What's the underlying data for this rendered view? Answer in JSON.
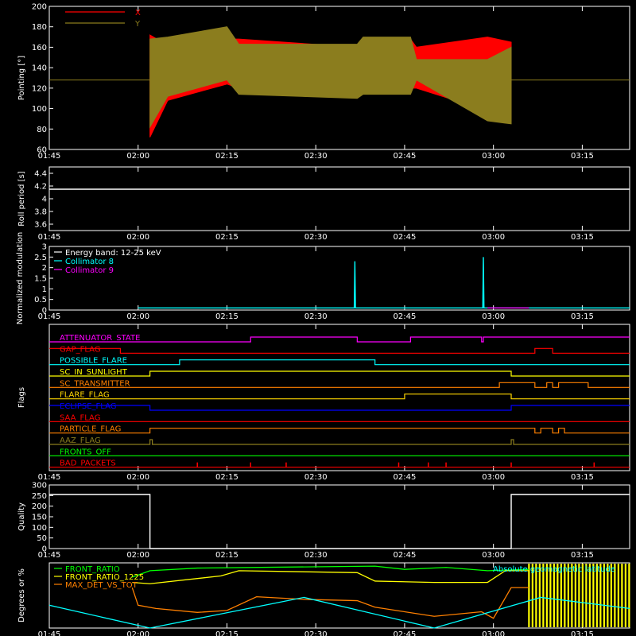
{
  "chart_data": [
    {
      "type": "line",
      "ylabel": "Pointing [°]",
      "ylim": [
        60,
        200
      ],
      "yticks": [
        60,
        80,
        100,
        120,
        140,
        160,
        180,
        200
      ],
      "xticks": [
        "01:45",
        "02:00",
        "02:15",
        "02:30",
        "02:45",
        "03:00",
        "03:15"
      ],
      "legend": {
        "placement": "top-left",
        "entries": [
          {
            "name": "X",
            "color": "#ff0000"
          },
          {
            "name": "Y",
            "color": "#8b7d1e"
          }
        ]
      },
      "series": [
        {
          "name": "X",
          "color": "#ff0000",
          "x": [
            "02:02",
            "02:05",
            "02:15",
            "02:17",
            "02:37",
            "02:38",
            "02:46",
            "02:47",
            "02:59",
            "03:03"
          ],
          "y_high": [
            172,
            162,
            168,
            168,
            160,
            168,
            168,
            160,
            170,
            165
          ],
          "y_low": [
            72,
            108,
            124,
            120,
            112,
            120,
            120,
            120,
            98,
            88
          ]
        },
        {
          "name": "Y",
          "color": "#8b7d1e",
          "x": [
            "02:02",
            "02:05",
            "02:15",
            "02:17",
            "02:37",
            "02:38",
            "02:46",
            "02:47",
            "02:59",
            "03:03"
          ],
          "y_high": [
            168,
            170,
            180,
            163,
            163,
            170,
            170,
            148,
            148,
            160
          ],
          "y_low": [
            82,
            112,
            128,
            114,
            110,
            114,
            114,
            128,
            88,
            85
          ]
        }
      ],
      "baseline": 128
    },
    {
      "type": "line",
      "ylabel": "Roll period [s]",
      "ylim": [
        3.5,
        4.5
      ],
      "yticks": [
        3.6,
        3.8,
        4.0,
        4.2,
        4.4
      ],
      "xticks": [
        "01:45",
        "02:00",
        "02:15",
        "02:30",
        "02:45",
        "03:00",
        "03:15"
      ],
      "series": [
        {
          "x": [
            "01:45",
            "03:23"
          ],
          "y": [
            4.15,
            4.15
          ],
          "color": "#ffffff"
        }
      ]
    },
    {
      "type": "line",
      "ylabel": "Normalized modulation",
      "ylim": [
        0,
        3.0
      ],
      "yticks": [
        0.0,
        0.5,
        1.0,
        1.5,
        2.0,
        2.5,
        3.0
      ],
      "xticks": [
        "01:45",
        "02:00",
        "02:15",
        "02:30",
        "02:45",
        "03:00",
        "03:15"
      ],
      "legend": {
        "placement": "top-left",
        "entries": [
          {
            "name": "Energy band: 12-25 keV",
            "color": "#ffffff"
          },
          {
            "name": "Collimator 8",
            "color": "#00ffff"
          },
          {
            "name": "Collimator 9",
            "color": "#ff00ff"
          }
        ]
      },
      "series": [
        {
          "name": "Collimator 8",
          "color": "#00ffff",
          "x": [
            "02:00",
            "02:36.5",
            "02:36.6",
            "02:36.7",
            "02:58.2",
            "02:58.3",
            "02:58.4",
            "03:06",
            "03:23"
          ],
          "y": [
            0.1,
            0.1,
            2.3,
            0.1,
            0.1,
            2.5,
            0.1,
            0.1,
            0.1
          ]
        },
        {
          "name": "Collimator 9",
          "color": "#ff00ff",
          "x": [
            "02:59",
            "03:06"
          ],
          "y": [
            0.1,
            0.1
          ]
        }
      ]
    },
    {
      "type": "step",
      "ylabel": "Flags",
      "xticks": [
        "01:45",
        "02:00",
        "02:15",
        "02:30",
        "02:45",
        "03:00",
        "03:15"
      ],
      "flags": [
        {
          "name": "ATTENUATOR_STATE",
          "color": "#ff00ff",
          "steps": [
            [
              "01:45",
              0
            ],
            [
              "02:19",
              1
            ],
            [
              "02:37",
              0
            ],
            [
              "02:46",
              1
            ],
            [
              "02:58",
              0
            ],
            [
              "02:58.3",
              1
            ]
          ]
        },
        {
          "name": "GAP_FLAG",
          "color": "#ff0000",
          "steps": [
            [
              "01:45",
              1
            ],
            [
              "01:57",
              0
            ],
            [
              "03:07",
              1
            ],
            [
              "03:10",
              0
            ]
          ]
        },
        {
          "name": "POSSIBLE_FLARE",
          "color": "#00ffff",
          "steps": [
            [
              "01:45",
              0
            ],
            [
              "02:07",
              1
            ],
            [
              "02:40",
              0
            ]
          ]
        },
        {
          "name": "SC_IN_SUNLIGHT",
          "color": "#ffff00",
          "steps": [
            [
              "01:45",
              0
            ],
            [
              "02:02",
              1
            ],
            [
              "03:03",
              0
            ]
          ]
        },
        {
          "name": "SC_TRANSMITTER",
          "color": "#ff8000",
          "steps": [
            [
              "01:45",
              0
            ],
            [
              "03:01",
              1
            ],
            [
              "03:07",
              0
            ],
            [
              "03:09",
              1
            ],
            [
              "03:10",
              0
            ],
            [
              "03:11",
              1
            ],
            [
              "03:16",
              0
            ]
          ]
        },
        {
          "name": "FLARE_FLAG",
          "color": "#ffd700",
          "steps": [
            [
              "01:45",
              0
            ],
            [
              "02:45",
              1
            ],
            [
              "03:03",
              0
            ]
          ]
        },
        {
          "name": "ECLIPSE_FLAG",
          "color": "#0000ff",
          "steps": [
            [
              "01:45",
              1
            ],
            [
              "02:02",
              0
            ],
            [
              "03:03",
              1
            ]
          ]
        },
        {
          "name": "SAA_FLAG",
          "color": "#ff0000",
          "steps": [
            [
              "01:45",
              0
            ]
          ]
        },
        {
          "name": "PARTICLE_FLAG",
          "color": "#ff8000",
          "steps": [
            [
              "01:45",
              0
            ],
            [
              "02:02",
              1
            ],
            [
              "03:07",
              0
            ],
            [
              "03:08",
              1
            ],
            [
              "03:10",
              0
            ],
            [
              "03:11",
              1
            ],
            [
              "03:12",
              0
            ]
          ]
        },
        {
          "name": "AAZ_FLAG",
          "color": "#8b7d1e",
          "steps": [
            [
              "01:45",
              0
            ],
            [
              "02:02",
              1
            ],
            [
              "02:02.4",
              0
            ],
            [
              "03:03",
              1
            ],
            [
              "03:03.4",
              0
            ]
          ]
        },
        {
          "name": "FRONTS_OFF",
          "color": "#00ff00",
          "steps": [
            [
              "01:45",
              0
            ]
          ]
        },
        {
          "name": "BAD_PACKETS",
          "color": "#ff0000",
          "steps": [
            [
              "01:45",
              0
            ]
          ],
          "spikes": [
            "02:10",
            "02:19",
            "02:25",
            "02:44",
            "02:49",
            "02:52",
            "03:03",
            "03:17"
          ]
        }
      ]
    },
    {
      "type": "line",
      "ylabel": "Quality",
      "ylim": [
        0,
        300
      ],
      "yticks": [
        0,
        50,
        100,
        150,
        200,
        250,
        300
      ],
      "xticks": [
        "01:45",
        "02:00",
        "02:15",
        "02:30",
        "02:45",
        "03:00",
        "03:15"
      ],
      "series": [
        {
          "x": [
            "01:45",
            "02:02",
            "02:02",
            "03:03",
            "03:03",
            "03:23"
          ],
          "y": [
            255,
            255,
            0,
            0,
            255,
            255
          ],
          "color": "#ffffff"
        }
      ]
    },
    {
      "type": "line",
      "ylabel": "Degrees or %",
      "ylim": [
        0,
        100
      ],
      "xticks": [
        "01:45",
        "02:00",
        "02:15",
        "02:30",
        "02:45",
        "03:00",
        "03:15"
      ],
      "legend": {
        "placement": "top",
        "entries": [
          {
            "name": "FRONT_RATIO",
            "color": "#00ff00"
          },
          {
            "name": "FRONT_RATIO_1225",
            "color": "#ffff00"
          },
          {
            "name": "MAX_DET_VS_TOT",
            "color": "#ff8000"
          },
          {
            "name": "Absolute geomagnetic latitude",
            "color": "#00ffff"
          }
        ]
      },
      "series": [
        {
          "name": "FRONT_RATIO",
          "color": "#00ff00",
          "x": [
            "01:59",
            "02:02",
            "02:10",
            "02:40",
            "02:45",
            "02:52",
            "02:59",
            "03:06"
          ],
          "y": [
            78,
            88,
            92,
            95,
            90,
            93,
            88,
            90
          ]
        },
        {
          "name": "FRONT_RATIO_1225",
          "color": "#ffff00",
          "x": [
            "01:59",
            "02:02",
            "02:14",
            "02:17",
            "02:37",
            "02:40",
            "02:50",
            "02:59",
            "03:02",
            "03:06"
          ],
          "y": [
            70,
            68,
            80,
            88,
            85,
            72,
            70,
            70,
            88,
            88
          ]
        },
        {
          "name": "MAX_DET_VS_TOT",
          "color": "#ff8000",
          "x": [
            "01:59",
            "02:00",
            "02:03",
            "02:10",
            "02:15",
            "02:20",
            "02:28",
            "02:37",
            "02:40",
            "02:50",
            "02:58",
            "03:00",
            "03:03",
            "03:06"
          ],
          "y": [
            62,
            35,
            30,
            24,
            27,
            48,
            44,
            42,
            32,
            18,
            25,
            15,
            62,
            62
          ]
        },
        {
          "name": "Absolute geomagnetic latitude",
          "color": "#00ffff",
          "x": [
            "01:45",
            "02:02",
            "02:28",
            "02:50",
            "03:08",
            "03:23"
          ],
          "y": [
            35,
            0,
            47,
            0,
            47,
            30
          ]
        }
      ],
      "bad_region": {
        "x": [
          "03:06",
          "03:23"
        ],
        "color": "#ffff00"
      }
    }
  ]
}
